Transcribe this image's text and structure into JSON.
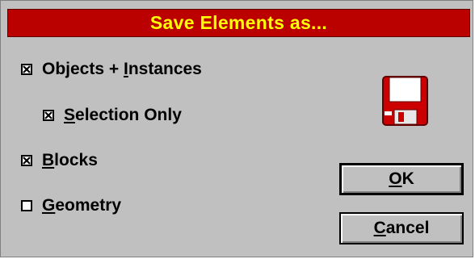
{
  "dialog": {
    "title": "Save Elements as..."
  },
  "options": [
    {
      "id": "objects",
      "pre": "Objects + ",
      "acc": "I",
      "post": "nstances",
      "checked": true
    },
    {
      "id": "selection",
      "pre": "",
      "acc": "S",
      "post": "election Only",
      "checked": true
    },
    {
      "id": "blocks",
      "pre": "",
      "acc": "B",
      "post": "locks",
      "checked": true
    },
    {
      "id": "geometry",
      "pre": "",
      "acc": "G",
      "post": "eometry",
      "checked": false
    }
  ],
  "buttons": {
    "ok": {
      "acc": "O",
      "post": "K"
    },
    "cancel": {
      "acc": "C",
      "post": "ancel"
    }
  },
  "colors": {
    "titlebar": "#bb0000",
    "title_text": "#ffff00",
    "dialog_bg": "#c0c0c0",
    "disk": "#cc0000"
  },
  "icons": {
    "disk": "floppy-disk-icon"
  }
}
